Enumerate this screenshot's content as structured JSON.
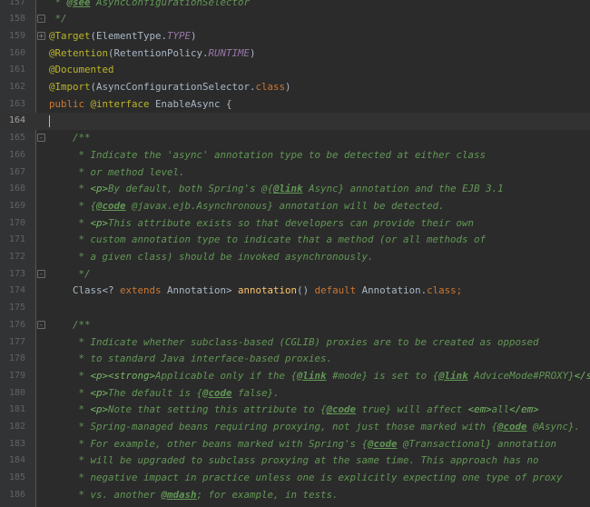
{
  "editor": {
    "lines": [
      {
        "n": "157",
        "fold": "",
        "tokens": [
          {
            "c": "doc",
            "t": " * "
          },
          {
            "c": "tag",
            "t": "@see"
          },
          {
            "c": "doc",
            "t": " AsyncConfigurationSelector"
          }
        ]
      },
      {
        "n": "158",
        "fold": "-",
        "tokens": [
          {
            "c": "doc",
            "t": " */"
          }
        ]
      },
      {
        "n": "159",
        "fold": "+",
        "tokens": [
          {
            "c": "ann",
            "t": "@Target"
          },
          {
            "c": "plain",
            "t": "(ElementType."
          },
          {
            "c": "const",
            "t": "TYPE"
          },
          {
            "c": "plain",
            "t": ")"
          }
        ]
      },
      {
        "n": "160",
        "fold": "",
        "tokens": [
          {
            "c": "ann",
            "t": "@Retention"
          },
          {
            "c": "plain",
            "t": "(RetentionPolicy."
          },
          {
            "c": "const",
            "t": "RUNTIME"
          },
          {
            "c": "plain",
            "t": ")"
          }
        ]
      },
      {
        "n": "161",
        "fold": "",
        "tokens": [
          {
            "c": "ann",
            "t": "@Documented"
          }
        ]
      },
      {
        "n": "162",
        "fold": "",
        "tokens": [
          {
            "c": "ann",
            "t": "@Import"
          },
          {
            "c": "plain",
            "t": "(AsyncConfigurationSelector."
          },
          {
            "c": "kw",
            "t": "class"
          },
          {
            "c": "plain",
            "t": ")"
          }
        ]
      },
      {
        "n": "163",
        "fold": "",
        "tokens": [
          {
            "c": "kw",
            "t": "public "
          },
          {
            "c": "ann",
            "t": "@interface"
          },
          {
            "c": "plain",
            "t": " EnableAsync {"
          }
        ]
      },
      {
        "n": "164",
        "fold": "",
        "current": true,
        "tokens": []
      },
      {
        "n": "165",
        "fold": "-",
        "tokens": [
          {
            "c": "doc",
            "t": "    /**"
          }
        ]
      },
      {
        "n": "166",
        "fold": "",
        "tokens": [
          {
            "c": "doc",
            "t": "     * Indicate the 'async' annotation type to be detected at either class"
          }
        ]
      },
      {
        "n": "167",
        "fold": "",
        "tokens": [
          {
            "c": "doc",
            "t": "     * or method level."
          }
        ]
      },
      {
        "n": "168",
        "fold": "",
        "tokens": [
          {
            "c": "doc",
            "t": "     * "
          },
          {
            "c": "htag",
            "t": "<p>"
          },
          {
            "c": "doc",
            "t": "By default, both Spring's @{"
          },
          {
            "c": "tag",
            "t": "@link"
          },
          {
            "c": "doc",
            "t": " Async} annotation and the EJB 3.1"
          }
        ]
      },
      {
        "n": "169",
        "fold": "",
        "tokens": [
          {
            "c": "doc",
            "t": "     * {"
          },
          {
            "c": "tag",
            "t": "@code"
          },
          {
            "c": "doc",
            "t": " @javax.ejb.Asynchronous} annotation will be detected."
          }
        ]
      },
      {
        "n": "170",
        "fold": "",
        "tokens": [
          {
            "c": "doc",
            "t": "     * "
          },
          {
            "c": "htag",
            "t": "<p>"
          },
          {
            "c": "doc",
            "t": "This attribute exists so that developers can provide their own"
          }
        ]
      },
      {
        "n": "171",
        "fold": "",
        "tokens": [
          {
            "c": "doc",
            "t": "     * custom annotation type to indicate that a method (or all methods of"
          }
        ]
      },
      {
        "n": "172",
        "fold": "",
        "tokens": [
          {
            "c": "doc",
            "t": "     * a given class) should be invoked asynchronously."
          }
        ]
      },
      {
        "n": "173",
        "fold": "-",
        "tokens": [
          {
            "c": "doc",
            "t": "     */"
          }
        ]
      },
      {
        "n": "174",
        "fold": "",
        "tokens": [
          {
            "c": "plain",
            "t": "    Class<? "
          },
          {
            "c": "kw",
            "t": "extends "
          },
          {
            "c": "plain",
            "t": "Annotation> "
          },
          {
            "c": "fn",
            "t": "annotation"
          },
          {
            "c": "plain",
            "t": "() "
          },
          {
            "c": "kw",
            "t": "default "
          },
          {
            "c": "plain",
            "t": "Annotation."
          },
          {
            "c": "kw",
            "t": "class;"
          }
        ]
      },
      {
        "n": "175",
        "fold": "",
        "tokens": []
      },
      {
        "n": "176",
        "fold": "-",
        "tokens": [
          {
            "c": "doc",
            "t": "    /**"
          }
        ]
      },
      {
        "n": "177",
        "fold": "",
        "tokens": [
          {
            "c": "doc",
            "t": "     * Indicate whether subclass-based (CGLIB) proxies are to be created as opposed"
          }
        ]
      },
      {
        "n": "178",
        "fold": "",
        "tokens": [
          {
            "c": "doc",
            "t": "     * to standard Java interface-based proxies."
          }
        ]
      },
      {
        "n": "179",
        "fold": "",
        "tokens": [
          {
            "c": "doc",
            "t": "     * "
          },
          {
            "c": "htag",
            "t": "<p><strong>"
          },
          {
            "c": "doc",
            "t": "Applicable only if the {"
          },
          {
            "c": "tag",
            "t": "@link"
          },
          {
            "c": "doc",
            "t": " #mode} is set to {"
          },
          {
            "c": "tag",
            "t": "@link"
          },
          {
            "c": "doc",
            "t": " AdviceMode#PROXY}"
          },
          {
            "c": "htag",
            "t": "</strong>"
          },
          {
            "c": "doc",
            "t": "."
          }
        ]
      },
      {
        "n": "180",
        "fold": "",
        "tokens": [
          {
            "c": "doc",
            "t": "     * "
          },
          {
            "c": "htag",
            "t": "<p>"
          },
          {
            "c": "doc",
            "t": "The default is {"
          },
          {
            "c": "tag",
            "t": "@code"
          },
          {
            "c": "doc",
            "t": " false}."
          }
        ]
      },
      {
        "n": "181",
        "fold": "",
        "tokens": [
          {
            "c": "doc",
            "t": "     * "
          },
          {
            "c": "htag",
            "t": "<p>"
          },
          {
            "c": "doc",
            "t": "Note that setting this attribute to {"
          },
          {
            "c": "tag",
            "t": "@code"
          },
          {
            "c": "doc",
            "t": " true} will affect "
          },
          {
            "c": "htag",
            "t": "<em>"
          },
          {
            "c": "doc",
            "t": "all"
          },
          {
            "c": "htag",
            "t": "</em>"
          }
        ]
      },
      {
        "n": "182",
        "fold": "",
        "tokens": [
          {
            "c": "doc",
            "t": "     * Spring-managed beans requiring proxying, not just those marked with {"
          },
          {
            "c": "tag",
            "t": "@code"
          },
          {
            "c": "doc",
            "t": " @Async}."
          }
        ]
      },
      {
        "n": "183",
        "fold": "",
        "tokens": [
          {
            "c": "doc",
            "t": "     * For example, other beans marked with Spring's {"
          },
          {
            "c": "tag",
            "t": "@code"
          },
          {
            "c": "doc",
            "t": " @Transactional} annotation"
          }
        ]
      },
      {
        "n": "184",
        "fold": "",
        "tokens": [
          {
            "c": "doc",
            "t": "     * will be upgraded to subclass proxying at the same time. This approach has no"
          }
        ]
      },
      {
        "n": "185",
        "fold": "",
        "tokens": [
          {
            "c": "doc",
            "t": "     * negative impact in practice unless one is explicitly expecting one type of proxy"
          }
        ]
      },
      {
        "n": "186",
        "fold": "",
        "tokens": [
          {
            "c": "doc",
            "t": "     * vs. another "
          },
          {
            "c": "tag",
            "t": "@mdash"
          },
          {
            "c": "doc",
            "t": "; for example, in tests."
          }
        ]
      }
    ]
  }
}
